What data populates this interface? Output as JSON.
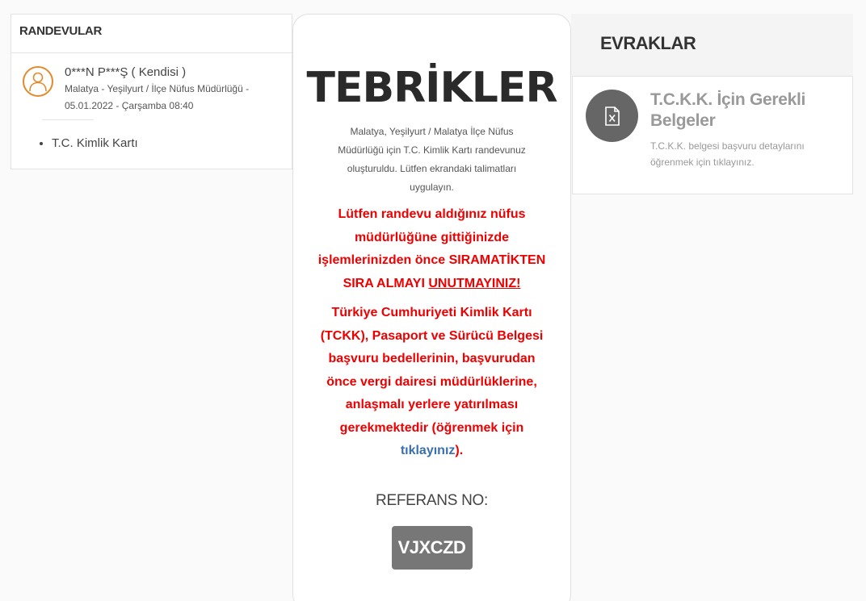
{
  "left": {
    "header": "RANDEVULAR",
    "appointment": {
      "name": "0***N P***Ş ( Kendisi )",
      "detail": "Malatya - Yeşilyurt / İlçe Nüfus Müdürlüğü - 05.01.2022 - Çarşamba 08:40",
      "items": [
        "T.C. Kimlik Kartı"
      ]
    }
  },
  "center": {
    "title": "TEBRİKLER",
    "message": "Malatya, Yeşilyurt / Malatya İlçe Nüfus Müdürlüğü için T.C. Kimlik Kartı randevunuz oluşturuldu. Lütfen ekrandaki talimatları uygulayın.",
    "warning1_text": "Lütfen randevu aldığınız nüfus müdürlüğüne gittiğinizde işlemlerinizden önce SIRAMATİKTEN SIRA ALMAYI ",
    "warning1_underline": "UNUTMAYINIZ!",
    "warning2_text": "Türkiye Cumhuriyeti Kimlik Kartı (TCKK), Pasaport ve Sürücü Belgesi başvuru bedellerinin, başvurudan önce vergi dairesi müdürlüklerine, anlaşmalı yerlere yatırılması gerekmektedir (öğrenmek için ",
    "warning2_link": "tıklayınız",
    "warning2_end": ").",
    "reference_label": "REFERANS NO:",
    "reference_code": "VJXCZD"
  },
  "right": {
    "header": "EVRAKLAR",
    "document": {
      "icon": "excel-file-icon",
      "title": "T.C.K.K. İçin Gerekli Belgeler",
      "description": "T.C.K.K. belgesi başvuru detaylarını öğrenmek için tıklayınız."
    }
  },
  "colors": {
    "accent_orange": "#e28b2d",
    "warning_red": "#ee0000",
    "link_blue": "#3a6fb0",
    "badge_gray": "#777777"
  }
}
